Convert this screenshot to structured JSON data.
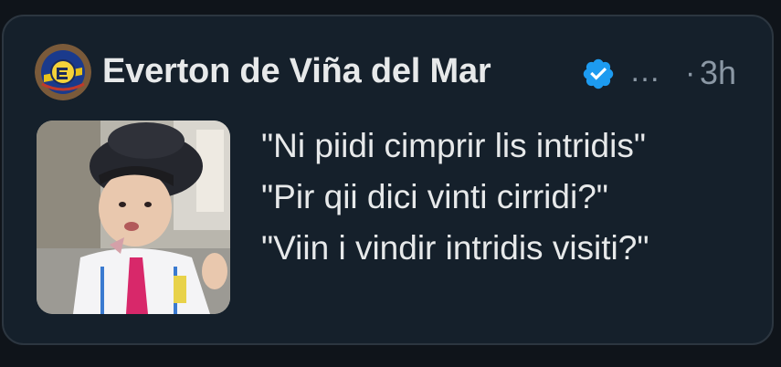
{
  "tweet": {
    "author_name": "Everton de Viña del Mar",
    "more_label": "…",
    "separator": "·",
    "timestamp": "3h",
    "lines": [
      "\"Ni piidi cimprir lis intridis\"",
      "\"Pir qii dici vinti cirridi?\"",
      "\"Viin i vindir intridis visiti?\""
    ]
  },
  "colors": {
    "background": "#15202b",
    "verified": "#1d9bf0",
    "text_primary": "#e7e9ea",
    "text_secondary": "#8b98a5"
  },
  "icons": {
    "verified": "verified-badge-icon",
    "avatar": "club-crest",
    "media": "photo-thumbnail"
  }
}
